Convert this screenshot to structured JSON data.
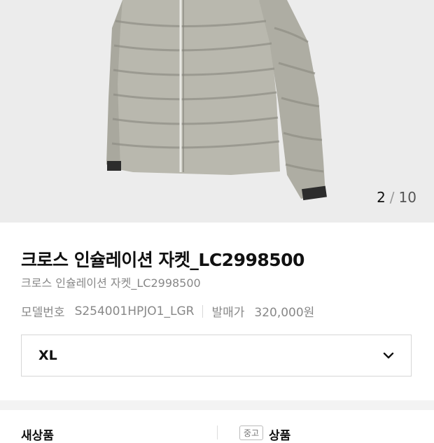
{
  "gallery": {
    "current": "2",
    "separator": "/",
    "total": "10",
    "image_alt": "jacket-product-image"
  },
  "product": {
    "title": "크로스 인슐레이션 자켓_LC2998500",
    "subtitle": "크로스 인슐레이션 자켓_LC2998500",
    "model_label": "모델번호",
    "model_value": "S254001HPJO1_LGR",
    "price_label": "발매가",
    "price_value": "320,000원"
  },
  "size_select": {
    "selected": "XL"
  },
  "condition": {
    "left_label": "새상품",
    "badge": "중고",
    "right_label": "상품"
  },
  "colors": {
    "image_bg": "#ececec",
    "jacket": "#b9b8ae"
  }
}
